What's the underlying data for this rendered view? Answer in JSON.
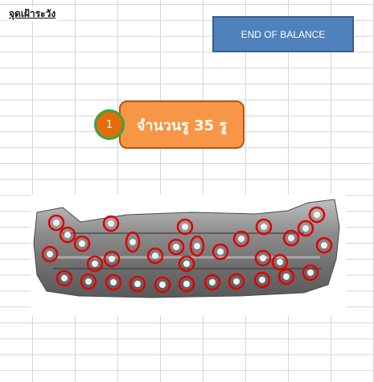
{
  "sheet": {
    "title": "จุดเฝ้าระวัง",
    "end_button_label": "END OF BALANCE",
    "step_number": "1",
    "hole_count_text": "จำนวนรู 35 รู"
  },
  "part_image": {
    "description_icon": "bumper-part-image",
    "marker_color": "#e00000"
  }
}
